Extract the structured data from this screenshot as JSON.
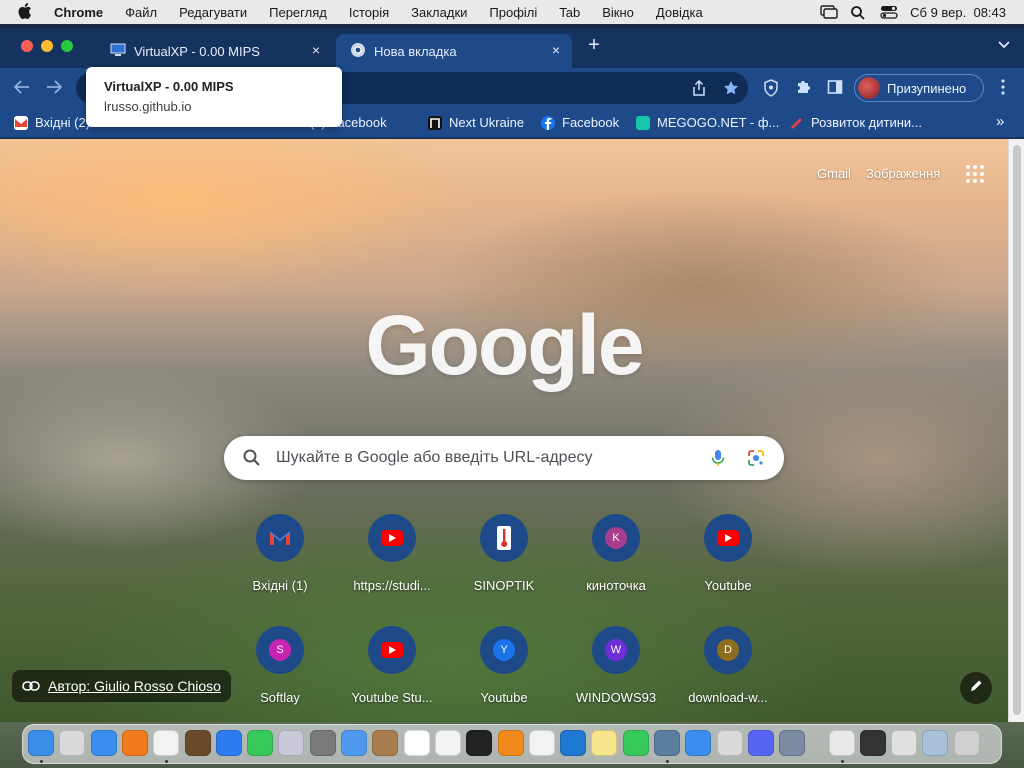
{
  "menubar": {
    "app": "Chrome",
    "items": [
      "Файл",
      "Редагувати",
      "Перегляд",
      "Історія",
      "Закладки",
      "Профілі",
      "Tab",
      "Вікно",
      "Довідка"
    ],
    "clock": "Сб 9 вер.  08:43"
  },
  "tabs": [
    {
      "title": "VirtualXP - 0.00 MIPS",
      "close": "×"
    },
    {
      "title": "Нова вкладка",
      "close": "×"
    }
  ],
  "newtab": "+",
  "tooltip": {
    "title": "VirtualXP - 0.00 MIPS",
    "url": "lrusso.github.io"
  },
  "profile": {
    "label": "Призупинено"
  },
  "bookmarks": [
    {
      "label": "Вхідні (2)"
    },
    {
      "label": "(1) Facebook"
    },
    {
      "label": "Next Ukraine"
    },
    {
      "label": "Facebook"
    },
    {
      "label": "MEGOGO.NET - ф..."
    },
    {
      "label": "Розвиток дитини..."
    }
  ],
  "bookmarks_more": "»",
  "top_links": {
    "gmail": "Gmail",
    "images": "Зображення"
  },
  "logo": "Google",
  "search": {
    "placeholder": "Шукайте в Google або введіть URL-адресу"
  },
  "shortcuts": [
    {
      "label": "Вхідні (1)",
      "letter": "M",
      "color": "#ea4335"
    },
    {
      "label": "https://studi...",
      "letter": "",
      "color": "#ff0000"
    },
    {
      "label": "SINOPTIK",
      "letter": "",
      "color": "#d32f2f"
    },
    {
      "label": "киноточка",
      "letter": "K",
      "color": "#a63d8f"
    },
    {
      "label": "Youtube",
      "letter": "",
      "color": "#ff0000"
    },
    {
      "label": "Softlay",
      "letter": "S",
      "color": "#c724b1"
    },
    {
      "label": "Youtube Stu...",
      "letter": "",
      "color": "#ff0000"
    },
    {
      "label": "Youtube",
      "letter": "Y",
      "color": "#1a73e8"
    },
    {
      "label": "WINDOWS93",
      "letter": "W",
      "color": "#6f2fd6"
    },
    {
      "label": "download-w...",
      "letter": "D",
      "color": "#8d6e1f"
    }
  ],
  "credit": {
    "label": "Автор: Giulio Rosso Chioso"
  },
  "dock_colors": [
    "#3b8ee8",
    "#d9d9d9",
    "#3a8ef0",
    "#f07a1c",
    "#f2f2f2",
    "#6b4a2b",
    "#2d7cf0",
    "#37c85a",
    "#c9c9d9",
    "#7a7a7a",
    "#4f9af0",
    "#a87c4c",
    "#ffffff",
    "#f2f2f2",
    "#222222",
    "#f08a1c",
    "#f2f2f2",
    "#1f78d1",
    "#f7e58c",
    "#37c85a",
    "#5a7ea0",
    "#3a8ef0",
    "#d9d9d9",
    "#5865f2",
    "#7a8aa0",
    "#e8e8e8",
    "#333333",
    "#e0e0e0",
    "#a8c0d8",
    "#d0d0d0"
  ]
}
